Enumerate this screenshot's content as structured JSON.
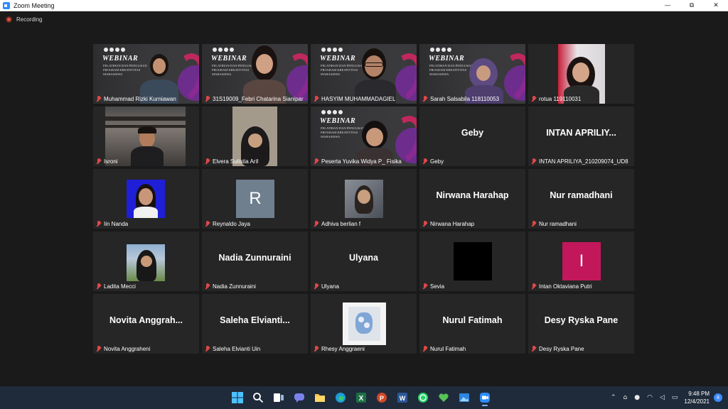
{
  "window": {
    "title": "Zoom Meeting",
    "controls": [
      "—",
      "⧉",
      "✕"
    ]
  },
  "recording": {
    "label": "Recording"
  },
  "webinar_banner": {
    "title": "WEBINAR",
    "subtitle": "PELATIHAN DAN PENULISAN PROGRAM KREATIVITAS MAHASISWA"
  },
  "participants": [
    {
      "name": "Muhammad Rizki Kurniawan",
      "display": ""
    },
    {
      "name": "31S19009_Febri Chatarina Sianipar",
      "display": ""
    },
    {
      "name": "HASYIM MUHAMMADAGIEL",
      "display": ""
    },
    {
      "name": "Sarah Salsabila 118110053",
      "display": ""
    },
    {
      "name": "rotua 119110031",
      "display": ""
    },
    {
      "name": "Isroni",
      "display": ""
    },
    {
      "name": "Elvera Sulistia Arif",
      "display": ""
    },
    {
      "name": "Peserta Yuvika Widya P_ Fisika",
      "display": ""
    },
    {
      "name": "Geby",
      "display": "Geby"
    },
    {
      "name": "INTAN APRILIYA_210209074_UD8",
      "display": "INTAN APRILIY..."
    },
    {
      "name": "Iin Nanda",
      "display": ""
    },
    {
      "name": "Reynaldo Jaya",
      "display": "",
      "initial": "R"
    },
    {
      "name": "Adhiva berlian f",
      "display": ""
    },
    {
      "name": "Nirwana Harahap",
      "display": "Nirwana Harahap"
    },
    {
      "name": "Nur ramadhani",
      "display": "Nur ramadhani"
    },
    {
      "name": "Ladita Mecci",
      "display": ""
    },
    {
      "name": "Nadia Zunnuraini",
      "display": "Nadia Zunnuraini"
    },
    {
      "name": "Ulyana",
      "display": "Ulyana"
    },
    {
      "name": "Sevia",
      "display": ""
    },
    {
      "name": "Intan Oktaviana Putri",
      "display": "",
      "initial": "I"
    },
    {
      "name": "Novita Anggraheni",
      "display": "Novita  Anggrah..."
    },
    {
      "name": "Saleha Elvianti Uin",
      "display": "Saleha  Elvianti..."
    },
    {
      "name": "Rhesy Anggraeni",
      "display": ""
    },
    {
      "name": "Nurul Fatimah",
      "display": "Nurul Fatimah"
    },
    {
      "name": "Desy Ryska Pane",
      "display": "Desy Ryska Pane"
    }
  ],
  "taskbar": {
    "apps": [
      "start-icon",
      "search-icon",
      "task-view-icon",
      "chat-icon",
      "file-explorer-icon",
      "edge-icon",
      "excel-icon",
      "powerpoint-icon",
      "word-icon",
      "whatsapp-icon",
      "heart-app-icon",
      "photos-icon",
      "zoom-icon"
    ],
    "time": "9:48 PM",
    "date": "12/4/2021",
    "notifications": "8"
  },
  "colors": {
    "meeting_bg": "#1a1a1a",
    "tile_bg": "#262626",
    "taskbar_bg": "#1f2b3b",
    "muted_mic": "#e04848",
    "initial_R_bg": "#6f7f8e",
    "initial_I_bg": "#c2185b"
  }
}
